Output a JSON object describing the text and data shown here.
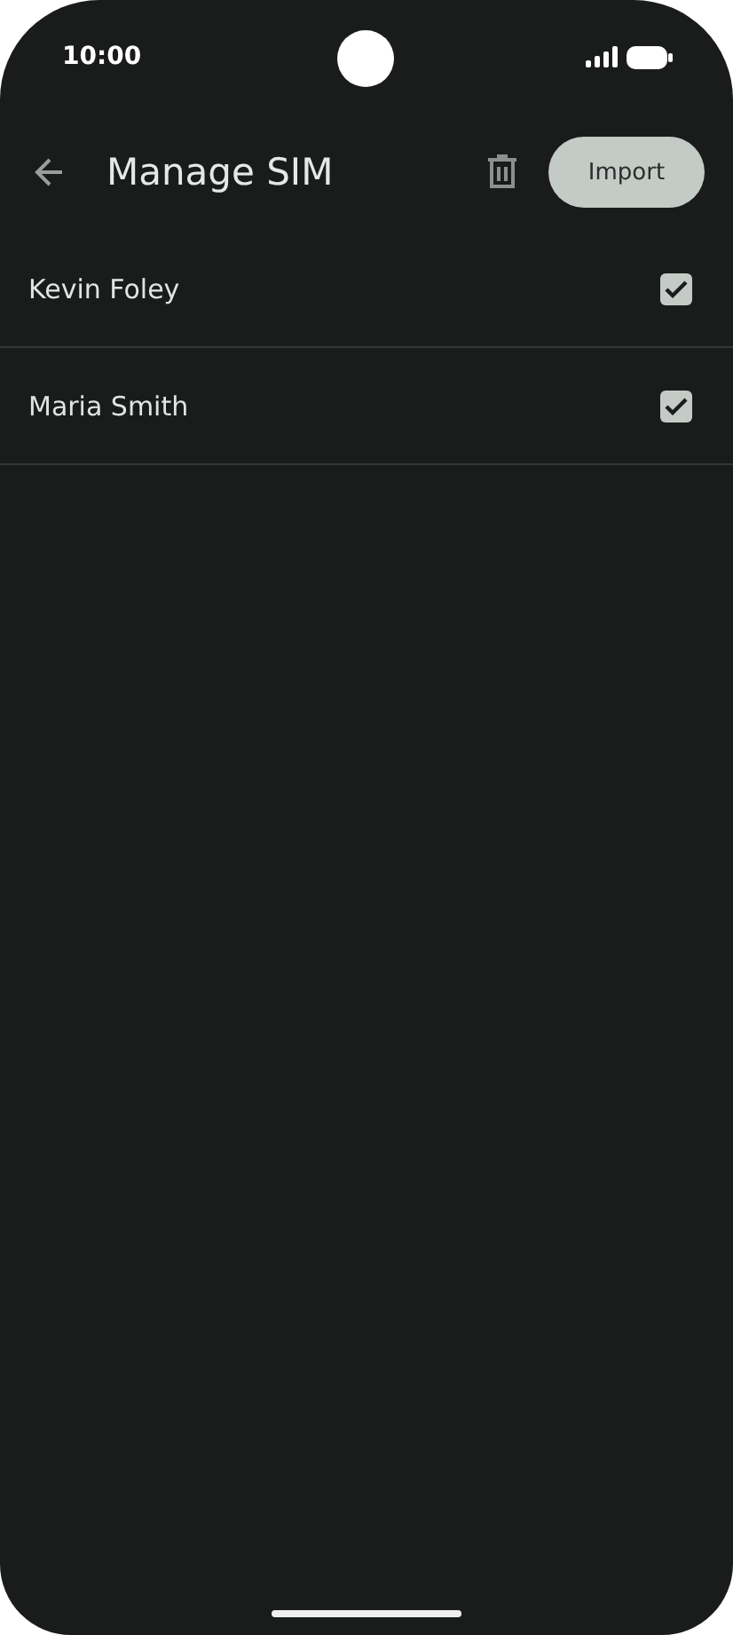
{
  "status_bar": {
    "time": "10:00"
  },
  "toolbar": {
    "title": "Manage SIM",
    "action": "Import"
  },
  "contacts": [
    {
      "name": "Kevin Foley",
      "checked": true
    },
    {
      "name": "Maria Smith",
      "checked": true
    }
  ]
}
